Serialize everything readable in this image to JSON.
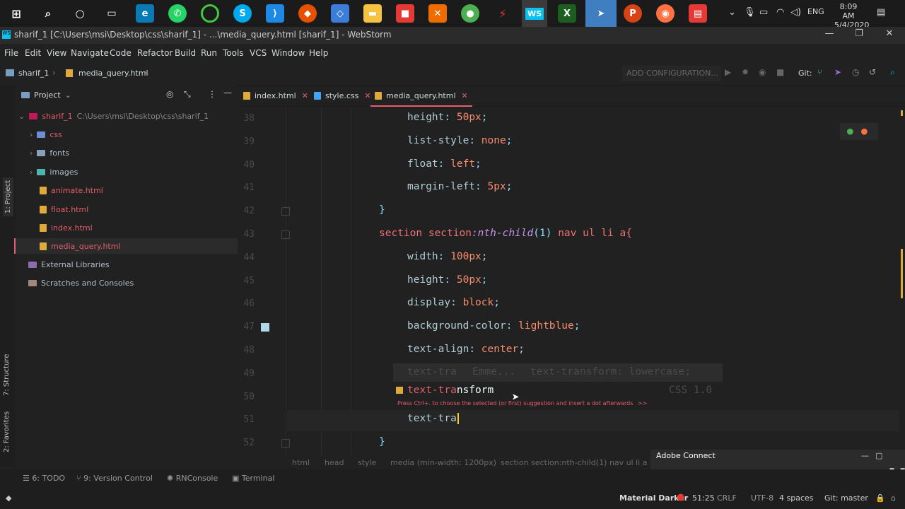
{
  "taskbar": {
    "time": "8:09 AM",
    "date": "5/4/2020",
    "language": "ENG"
  },
  "window": {
    "title": "sharif_1 [C:\\Users\\msi\\Desktop\\css\\sharif_1] - ...\\media_query.html [sharif_1] - WebStorm"
  },
  "menu": [
    "File",
    "Edit",
    "View",
    "Navigate",
    "Code",
    "Refactor",
    "Build",
    "Run",
    "Tools",
    "VCS",
    "Window",
    "Help"
  ],
  "navbar": {
    "crumb_project": "sharif_1",
    "crumb_file": "media_query.html",
    "add_config": "ADD CONFIGURATION...",
    "git_label": "Git:"
  },
  "leftstrip": {
    "project": "1: Project",
    "structure": "7: Structure",
    "favorites": "2: Favorites"
  },
  "project_panel": {
    "title": "Project",
    "root_name": "sharif_1",
    "root_path": "C:\\Users\\msi\\Desktop\\css\\sharif_1",
    "folders": [
      "css",
      "fonts",
      "images"
    ],
    "files": [
      "animate.html",
      "float.html",
      "index.html",
      "media_query.html"
    ],
    "external": "External Libraries",
    "scratches": "Scratches and Consoles"
  },
  "tabs": [
    "index.html",
    "style.css",
    "media_query.html"
  ],
  "editor": {
    "lines": [
      {
        "n": "38",
        "prop": "height",
        "val": "50px"
      },
      {
        "n": "39",
        "prop": "list-style",
        "val": "none"
      },
      {
        "n": "40",
        "prop": "float",
        "val": "left"
      },
      {
        "n": "41",
        "prop": "margin-left",
        "val": "5px"
      },
      {
        "n": "42",
        "brace": "}"
      },
      {
        "n": "43",
        "sel": "section section",
        "pseudo": ":nth-child",
        "arg": "(1)",
        "rest": " nav ul li a{"
      },
      {
        "n": "44",
        "prop": "width",
        "val": "100px"
      },
      {
        "n": "45",
        "prop": "height",
        "val": "50px"
      },
      {
        "n": "46",
        "prop": "display",
        "val": "block"
      },
      {
        "n": "47",
        "prop": "background-color",
        "val": "lightblue"
      },
      {
        "n": "48",
        "prop": "text-align",
        "val": "center"
      },
      {
        "n": "49"
      },
      {
        "n": "50"
      },
      {
        "n": "51",
        "typed": "text-tra"
      },
      {
        "n": "52",
        "brace": "}"
      }
    ],
    "popup": {
      "row1_left": "text-tra",
      "row1_mid": "Emme...",
      "row1_right": "text-transform: lowercase;",
      "row2_match": "text-tra",
      "row2_rest": "nsform",
      "row2_right": "CSS 1.0",
      "hint": "Press Ctrl+. to choose the selected (or first) suggestion and insert a dot afterwards",
      "hint_link": ">>"
    }
  },
  "breadcrumbs": [
    "html",
    "head",
    "style",
    "media (min-width: 1200px)",
    "section section:nth-child(1) nav ul li a"
  ],
  "bottom_tools": [
    "6: TODO",
    "9: Version Control",
    "RNConsole",
    "Terminal"
  ],
  "adobe": {
    "title": "Adobe Connect"
  },
  "status": {
    "theme": "Material Darker",
    "position": "51:25",
    "line_sep": "CRLF",
    "encoding": "UTF-8",
    "indent": "4 spaces",
    "git": "Git: master"
  }
}
